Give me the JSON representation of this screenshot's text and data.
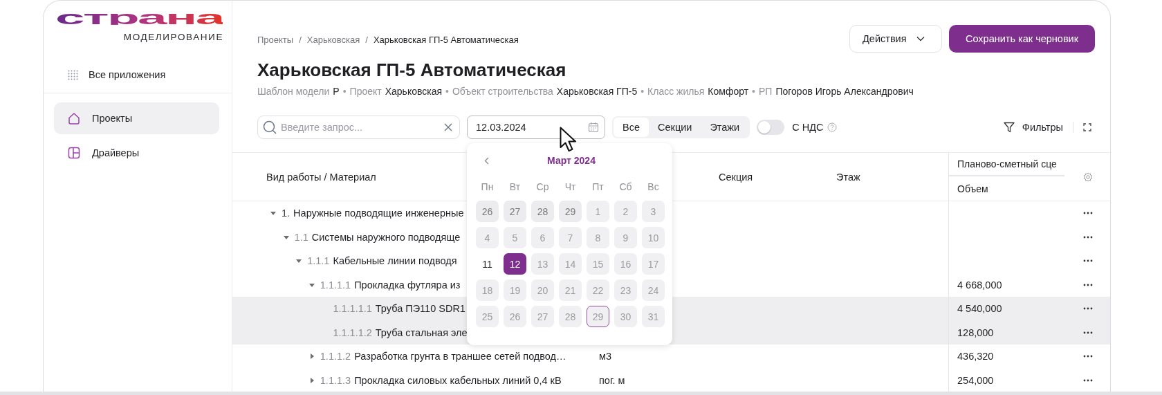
{
  "sidebar": {
    "logo": {
      "wordmark": "страна",
      "subtitle": "МОДЕЛИРОВАНИЕ"
    },
    "apps_link": "Все приложения",
    "items": [
      {
        "label": "Проекты",
        "selected": true
      },
      {
        "label": "Драйверы",
        "selected": false
      }
    ]
  },
  "breadcrumbs": [
    {
      "label": "Проекты",
      "current": false
    },
    {
      "separator": "/",
      "label": "Харьковская",
      "current": false
    },
    {
      "separator": "/",
      "label": "Харьковская ГП-5 Автоматическая",
      "current": true
    }
  ],
  "title": "Харьковская ГП-5 Автоматическая",
  "meta": [
    {
      "label": "Шаблон модели",
      "value": "Р"
    },
    {
      "separator": "•",
      "label": "Проект",
      "value": "Харьковская"
    },
    {
      "separator": "•",
      "label": "Объект строительства",
      "value": "Харьковская ГП-5"
    },
    {
      "separator": "•",
      "label": "Класс жилья",
      "value": "Комфорт"
    },
    {
      "separator": "•",
      "label": "РП",
      "value": "Погоров Игорь Александрович"
    }
  ],
  "actions": {
    "menu_button": "Действия",
    "primary_button": "Сохранить как черновик"
  },
  "toolbar": {
    "search": {
      "placeholder": "Введите запрос..."
    },
    "date": {
      "value": "12.03.2024"
    },
    "segments": [
      {
        "label": "Все",
        "selected": true
      },
      {
        "label": "Секции",
        "selected": false
      },
      {
        "label": "Этажи",
        "selected": false
      }
    ],
    "vat_toggle": {
      "label": "С НДС",
      "on": false
    },
    "filters_button": "Фильтры"
  },
  "calendar": {
    "month": "Март 2024",
    "weekdays": [
      "Пн",
      "Вт",
      "Ср",
      "Чт",
      "Пт",
      "Сб",
      "Вс"
    ],
    "days": [
      {
        "day": "26",
        "kind": "outside",
        "selected": false,
        "today": false
      },
      {
        "day": "27",
        "kind": "outside",
        "selected": false,
        "today": false
      },
      {
        "day": "28",
        "kind": "outside",
        "selected": false,
        "today": false
      },
      {
        "day": "29",
        "kind": "outside",
        "selected": false,
        "today": false
      },
      {
        "day": "1",
        "kind": "disabled",
        "selected": false,
        "today": false
      },
      {
        "day": "2",
        "kind": "disabled",
        "selected": false,
        "today": false
      },
      {
        "day": "3",
        "kind": "disabled",
        "selected": false,
        "today": false
      },
      {
        "day": "4",
        "kind": "disabled",
        "selected": false,
        "today": false
      },
      {
        "day": "5",
        "kind": "disabled",
        "selected": false,
        "today": false
      },
      {
        "day": "6",
        "kind": "disabled",
        "selected": false,
        "today": false
      },
      {
        "day": "7",
        "kind": "disabled",
        "selected": false,
        "today": false
      },
      {
        "day": "8",
        "kind": "disabled",
        "selected": false,
        "today": false
      },
      {
        "day": "9",
        "kind": "disabled",
        "selected": false,
        "today": false
      },
      {
        "day": "10",
        "kind": "disabled",
        "selected": false,
        "today": false
      },
      {
        "day": "11",
        "kind": "available",
        "selected": false,
        "today": false
      },
      {
        "day": "12",
        "kind": "available",
        "selected": true,
        "today": false
      },
      {
        "day": "13",
        "kind": "disabled",
        "selected": false,
        "today": false
      },
      {
        "day": "14",
        "kind": "disabled",
        "selected": false,
        "today": false
      },
      {
        "day": "15",
        "kind": "disabled",
        "selected": false,
        "today": false
      },
      {
        "day": "16",
        "kind": "disabled",
        "selected": false,
        "today": false
      },
      {
        "day": "17",
        "kind": "disabled",
        "selected": false,
        "today": false
      },
      {
        "day": "18",
        "kind": "disabled",
        "selected": false,
        "today": false
      },
      {
        "day": "19",
        "kind": "disabled",
        "selected": false,
        "today": false
      },
      {
        "day": "20",
        "kind": "disabled",
        "selected": false,
        "today": false
      },
      {
        "day": "21",
        "kind": "disabled",
        "selected": false,
        "today": false
      },
      {
        "day": "22",
        "kind": "disabled",
        "selected": false,
        "today": false
      },
      {
        "day": "23",
        "kind": "disabled",
        "selected": false,
        "today": false
      },
      {
        "day": "24",
        "kind": "disabled",
        "selected": false,
        "today": false
      },
      {
        "day": "25",
        "kind": "disabled",
        "selected": false,
        "today": false
      },
      {
        "day": "26",
        "kind": "disabled",
        "selected": false,
        "today": false
      },
      {
        "day": "27",
        "kind": "disabled",
        "selected": false,
        "today": false
      },
      {
        "day": "28",
        "kind": "disabled",
        "selected": false,
        "today": false
      },
      {
        "day": "29",
        "kind": "disabled",
        "selected": false,
        "today": true
      },
      {
        "day": "30",
        "kind": "disabled",
        "selected": false,
        "today": false
      },
      {
        "day": "31",
        "kind": "disabled",
        "selected": false,
        "today": false
      }
    ]
  },
  "table": {
    "columns": [
      {
        "label": "Вид работы / Материал"
      },
      {
        "label": "Секция"
      },
      {
        "label": "Этаж"
      },
      {
        "label": "Планово-сметный сце",
        "sub": "Объем"
      }
    ],
    "rows": [
      {
        "number": "1.",
        "name": "Наружные подводящие инженерные",
        "expanded": true,
        "selected": false,
        "children": [
          {
            "number": "1.1",
            "name": "Системы наружного подводяще",
            "expanded": true,
            "selected": false,
            "children": [
              {
                "number": "1.1.1",
                "name": "Кабельные линии подводя",
                "expanded": true,
                "selected": false,
                "children": [
                  {
                    "number": "1.1.1.1",
                    "name": "Прокладка футляра из",
                    "volume": "4 668,000",
                    "expanded": true,
                    "selected": false,
                    "children": [
                      {
                        "number": "1.1.1.1.1",
                        "name": "Труба ПЭ110 SDR1",
                        "volume": "4 540,000",
                        "selected": true
                      },
                      {
                        "number": "1.1.1.1.2",
                        "name": "Труба стальная эле",
                        "volume": "128,000",
                        "selected": true
                      }
                    ]
                  },
                  {
                    "number": "1.1.1.2",
                    "name": "Разработка грунта в траншее сетей подвод…",
                    "unit": "м3",
                    "volume": "436,320",
                    "expanded": false,
                    "selected": false
                  },
                  {
                    "number": "1.1.1.3",
                    "name": "Прокладка силовых кабельных линий 0,4 кВ",
                    "unit": "пог. м",
                    "volume": "254,000",
                    "expanded": false,
                    "selected": false
                  }
                ]
              }
            ]
          }
        ]
      }
    ]
  }
}
